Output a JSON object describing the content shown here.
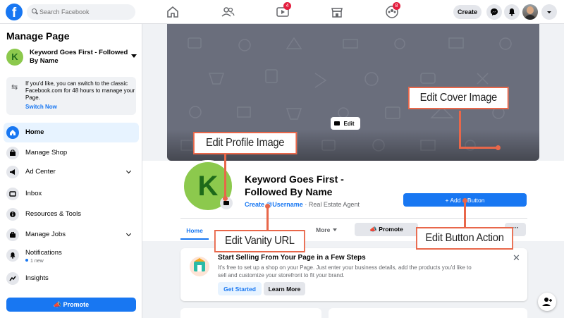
{
  "topbar": {
    "logo": "f",
    "search_placeholder": "Search Facebook",
    "video_badge": "4",
    "groups_badge": "8",
    "create_label": "Create"
  },
  "sidebar": {
    "title": "Manage Page",
    "page_initial": "K",
    "page_name": "Keyword Goes First - Followed By Name",
    "info_text": "If you'd like, you can switch to the classic\nFacebook.com for 48 hours to manage your\nPage.",
    "info_link": "Switch Now",
    "items": [
      {
        "label": "Home"
      },
      {
        "label": "Manage Shop"
      },
      {
        "label": "Ad Center"
      },
      {
        "label": "Inbox"
      },
      {
        "label": "Resources & Tools"
      },
      {
        "label": "Manage Jobs"
      },
      {
        "label": "Notifications",
        "sub": "1 new"
      },
      {
        "label": "Insights"
      }
    ],
    "promote_label": "Promote"
  },
  "page": {
    "cover_edit_label": "Edit",
    "profile_initial": "K",
    "title": "Keyword Goes First - Followed By Name",
    "vanity_link": "Create @Username",
    "category": " · Real Estate Agent",
    "add_button_label": "+  Add a Button",
    "tabs": {
      "home": "Home",
      "more": "More",
      "promote": "Promote",
      "dots": "···"
    }
  },
  "selling_card": {
    "title": "Start Selling From Your Page in a Few Steps",
    "description": "It's free to set up a shop on your Page. Just enter your business details, add the products you'd like to\nsell and customize your storefront to fit your brand.",
    "get_started": "Get Started",
    "learn_more": "Learn More",
    "close": "✕"
  },
  "annotations": {
    "cover": "Edit Cover Image",
    "profile": "Edit Profile Image",
    "vanity": "Edit Vanity URL",
    "button": "Edit Button Action"
  },
  "colors": {
    "brand": "#1877f2",
    "annotation": "#e8674a",
    "profile_green": "#8cc94d"
  }
}
